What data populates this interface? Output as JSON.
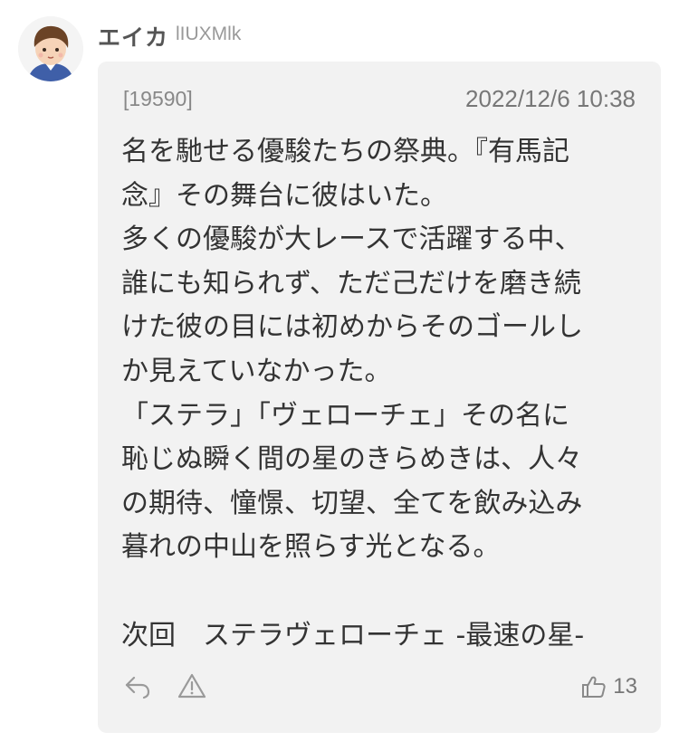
{
  "user": {
    "name": "エイカ",
    "id": "lIUXMlk"
  },
  "post": {
    "number": "[19590]",
    "date": "2022/12/6 10:38",
    "lines": [
      "名を馳せる優駿たちの祭典。『有馬記",
      "念』その舞台に彼はいた。",
      "多くの優駿が大レースで活躍する中、",
      "誰にも知られず、ただ己だけを磨き続",
      "けた彼の目には初めからそのゴールし",
      "か見えていなかった。",
      "「ステラ」「ヴェローチェ」その名に",
      "恥じぬ瞬く間の星のきらめきは、人々",
      "の期待、憧憬、切望、全てを飲み込み",
      "暮れの中山を照らす光となる。",
      "",
      "次回　ステラヴェローチェ -最速の星-"
    ],
    "likes": "13"
  },
  "icons": {
    "reply": "reply-icon",
    "report": "warning-icon",
    "like": "thumbs-up-icon"
  },
  "colors": {
    "card_bg": "#f2f2f2",
    "text": "#333333",
    "meta": "#888888"
  }
}
